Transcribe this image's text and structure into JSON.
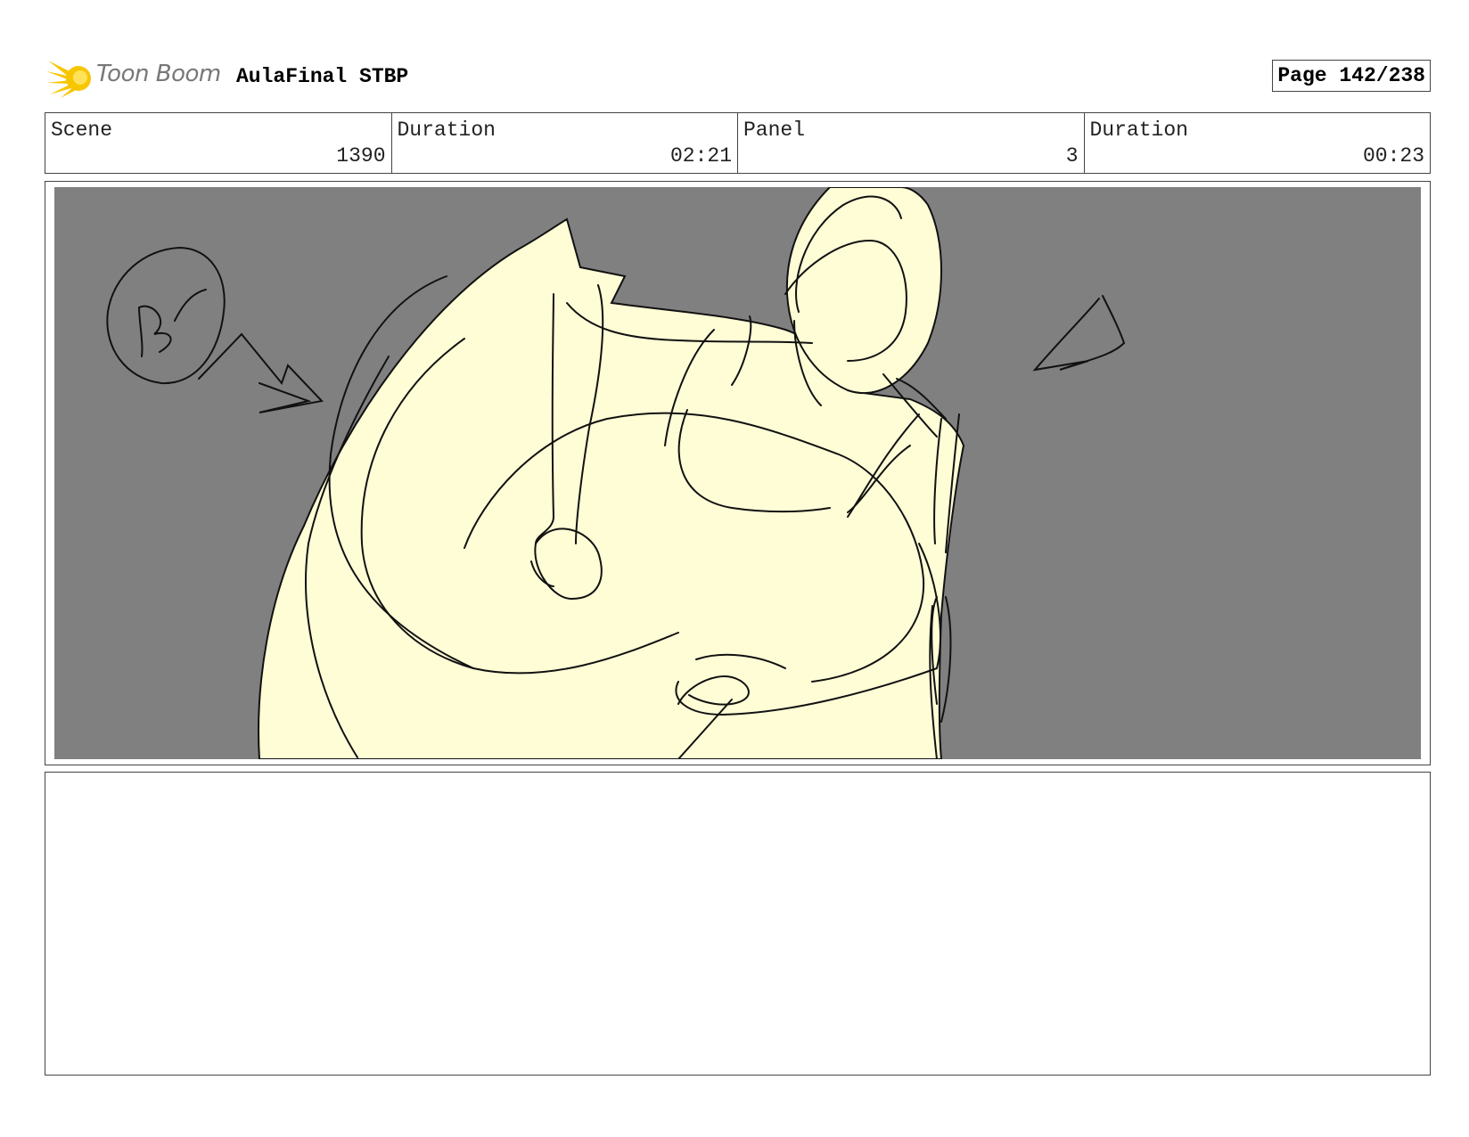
{
  "header": {
    "logo_text": "Toon Boom",
    "project_title": "AulaFinal STBP",
    "page": "Page 142/238"
  },
  "info": [
    {
      "label": "Scene",
      "value": "1390"
    },
    {
      "label": "Duration",
      "value": "02:21"
    },
    {
      "label": "Panel",
      "value": "3"
    },
    {
      "label": "Duration",
      "value": "00:23"
    }
  ],
  "colors": {
    "panel_background": "#808080",
    "sketch_fill": "#fffdd6",
    "stroke": "#111111",
    "logo_yellow": "#f7c600"
  },
  "sketch": {
    "annotation_text": "Bil"
  }
}
